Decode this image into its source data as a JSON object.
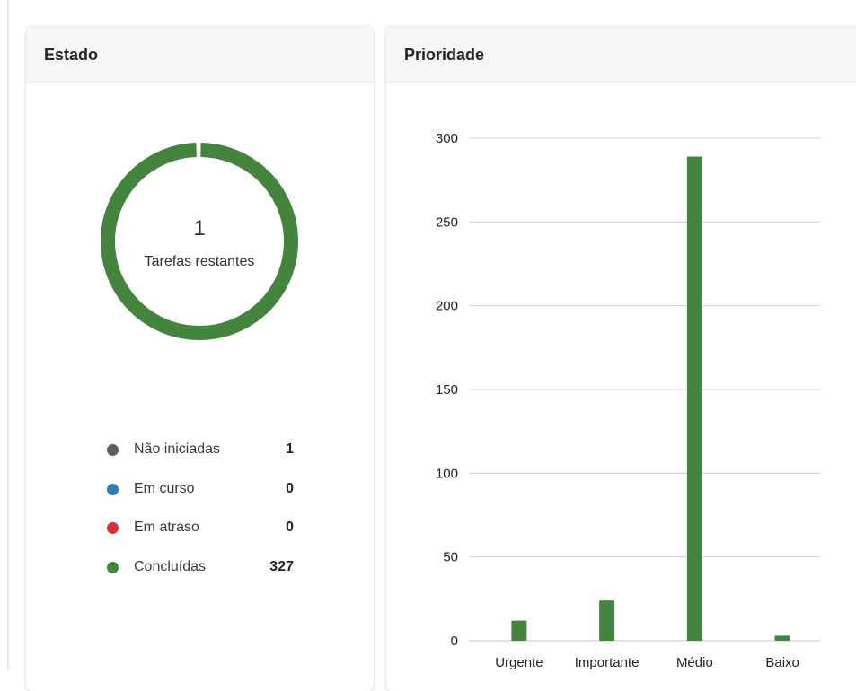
{
  "state_card": {
    "title": "Estado",
    "donut": {
      "count": "1",
      "label": "Tarefas restantes",
      "segments": [
        {
          "value": 327,
          "color": "#44843f"
        },
        {
          "value": 1,
          "color": "#ffffff"
        }
      ]
    },
    "legend": [
      {
        "label": "Não iniciadas",
        "value": "1",
        "color": "#605e5c"
      },
      {
        "label": "Em curso",
        "value": "0",
        "color": "#2f7db4"
      },
      {
        "label": "Em atraso",
        "value": "0",
        "color": "#d13438"
      },
      {
        "label": "Concluídas",
        "value": "327",
        "color": "#44843f"
      }
    ]
  },
  "priority_card": {
    "title": "Prioridade"
  },
  "chart_data": {
    "type": "bar",
    "categories": [
      "Urgente",
      "Importante",
      "Médio",
      "Baixo"
    ],
    "values": [
      12,
      24,
      289,
      3
    ],
    "ylim": [
      0,
      300
    ],
    "yticks": [
      0,
      50,
      100,
      150,
      200,
      250,
      300
    ],
    "grid": true,
    "color": "#44843f",
    "title": "",
    "xlabel": "",
    "ylabel": ""
  }
}
